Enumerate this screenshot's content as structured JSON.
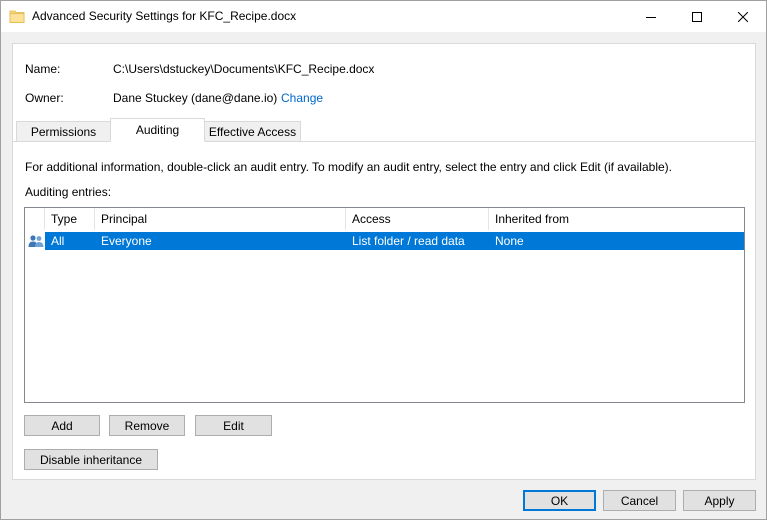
{
  "window": {
    "title": "Advanced Security Settings for KFC_Recipe.docx"
  },
  "fields": {
    "name_label": "Name:",
    "name_value": "C:\\Users\\dstuckey\\Documents\\KFC_Recipe.docx",
    "owner_label": "Owner:",
    "owner_value": "Dane Stuckey (dane@dane.io)",
    "change_link": "Change"
  },
  "tabs": [
    {
      "label": "Permissions",
      "active": false
    },
    {
      "label": "Auditing",
      "active": true
    },
    {
      "label": "Effective Access",
      "active": false
    }
  ],
  "auditing": {
    "info": "For additional information, double-click an audit entry. To modify an audit entry, select the entry and click Edit (if available).",
    "entries_label": "Auditing entries:",
    "columns": [
      "Type",
      "Principal",
      "Access",
      "Inherited from"
    ],
    "rows": [
      {
        "icon": "users-icon",
        "type": "All",
        "principal": "Everyone",
        "access": "List folder / read data",
        "inherited": "None",
        "selected": true
      }
    ],
    "selection_color": "#0078d7"
  },
  "buttons": {
    "add": "Add",
    "remove": "Remove",
    "edit": "Edit",
    "disable_inheritance": "Disable inheritance",
    "ok": "OK",
    "cancel": "Cancel",
    "apply": "Apply"
  },
  "colors": {
    "link": "#0066cc",
    "accent": "#0078d7"
  }
}
